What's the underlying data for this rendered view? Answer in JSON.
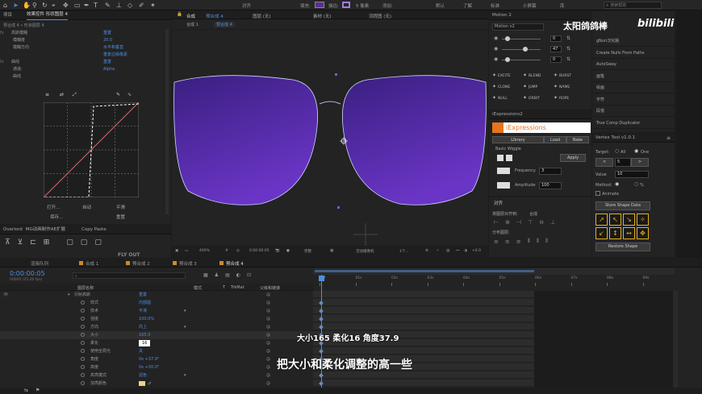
{
  "toolbar": {
    "snap": "对齐",
    "fill": "填充:",
    "stroke": "描边:",
    "stroke_px": "5 像素",
    "add": "添加:",
    "workspaces": [
      "默认",
      "了解",
      "标准",
      "小屏幕",
      "库"
    ],
    "search_placeholder": "搜索帮助"
  },
  "project": {
    "tab": "项目",
    "effect_tab": "效果控件 形状图层 4",
    "breadcrumb": "预合成 4 • 形状图层 4"
  },
  "effects": [
    {
      "label": "高斯模糊",
      "value": "重置",
      "indent": 0,
      "fx": true
    },
    {
      "label": "模糊度",
      "value": "20.0",
      "indent": 1
    },
    {
      "label": "模糊方向",
      "value": "水平和垂直",
      "indent": 1
    },
    {
      "label": "",
      "value": "重复边缘像素",
      "indent": 1
    },
    {
      "label": "曲线",
      "value": "重置",
      "indent": 0,
      "fx": true
    },
    {
      "label": "通道:",
      "value": "Alpha",
      "indent": 1
    },
    {
      "label": "曲线",
      "value": "",
      "indent": 1
    }
  ],
  "curve_buttons": [
    "打开...",
    "自动",
    "平滑",
    "保存...",
    "重置"
  ],
  "overlord": {
    "tab": "Overlord",
    "tab2": "MG动画制作AE扩展",
    "copy_paste": "Copy Paste",
    "fly_out": "FLY OUT"
  },
  "comp": {
    "tab_label": "合成",
    "comp_name": "预合成 4",
    "layer_none": "图层 (无)",
    "footage_none": "素材 (无)",
    "flow_none": "流程图 (无)",
    "sub_tabs": [
      "合成 1",
      "预合成 4"
    ]
  },
  "viewer": {
    "zoom": "400%",
    "timecode": "0:00:00:05",
    "quality": "完整",
    "camera": "活动摄像机",
    "views": "1个...",
    "offset": "+0.0"
  },
  "motion": {
    "title": "Motion 2",
    "version": "Motion v2",
    "values": [
      "0",
      "47",
      "0"
    ],
    "buttons": [
      "EXCITE",
      "BLEND",
      "BURST",
      "CLONE",
      "JUMP",
      "NAME",
      "NULL",
      "ORBIT",
      "ROPE"
    ]
  },
  "iexp": {
    "panel": "iExpressions2",
    "title": "iExpressions",
    "tabs": [
      "Library",
      "Load",
      "Bake"
    ],
    "preset": "Basic Wiggle",
    "apply": "Apply",
    "freq_label": "Frequency",
    "freq_value": "3",
    "amp_label": "Amplitude",
    "amp_value": "100"
  },
  "align": {
    "title": "对齐",
    "to": "将图层对齐到:",
    "target": "合成",
    "distribute": "分布图层:"
  },
  "plugins": [
    "gNun汉化版",
    "Create Nulls From Paths",
    "AutoSway",
    "画笔",
    "绘画",
    "字符",
    "段落",
    "True Comp Duplicator"
  ],
  "vertex": {
    "title": "Vertex Tool v1.0.1",
    "target_label": "Target:",
    "opt_all": "All",
    "opt_one": "One",
    "step": "5",
    "value_label": "Value",
    "value": "10",
    "method_label": "Method:",
    "pct": "%",
    "animate": "Animate",
    "store": "Store Shape Data",
    "restore": "Restore Shape"
  },
  "watermark": {
    "name": "太阳鸽鸽棒",
    "brand": "bilibili"
  },
  "timeline": {
    "tabs": [
      "渲染队列",
      "合成 1",
      "预合成 2",
      "预合成 3",
      "预合成 4"
    ],
    "timecode": "0:00:00:05",
    "fps": "00005 (25.00 fps)",
    "columns": [
      "图层名称",
      "模式",
      "T",
      "TrkMat",
      "父级和链接"
    ],
    "ruler": [
      "00f",
      "01s",
      "02s",
      "03s",
      "04s",
      "05s",
      "06s",
      "07s",
      "08s",
      "09s"
    ]
  },
  "tl_rows": [
    {
      "label": "衍射高斯",
      "value": "重置",
      "indent": 1
    },
    {
      "label": "样式",
      "value": "内部圆",
      "indent": 2
    },
    {
      "label": "技术",
      "value": "平滑",
      "indent": 2
    },
    {
      "label": "强度",
      "value": "100.0%",
      "indent": 2
    },
    {
      "label": "方向",
      "value": "向上",
      "indent": 2
    },
    {
      "label": "大小",
      "value": "165.0",
      "indent": 2
    },
    {
      "label": "柔化",
      "value": "16",
      "indent": 2
    },
    {
      "label": "使用全局光",
      "value": "关",
      "indent": 2
    },
    {
      "label": "角度",
      "value": "0x +37.9°",
      "indent": 2
    },
    {
      "label": "高度",
      "value": "0x +30.0°",
      "indent": 2
    },
    {
      "label": "高亮模式",
      "value": "滤色",
      "indent": 2
    },
    {
      "label": "加亮颜色",
      "value": "",
      "indent": 2
    }
  ],
  "subtitles": {
    "line1": "大小165  柔化16  角度37.9",
    "line2": "把大小和柔化调整的高一些"
  }
}
